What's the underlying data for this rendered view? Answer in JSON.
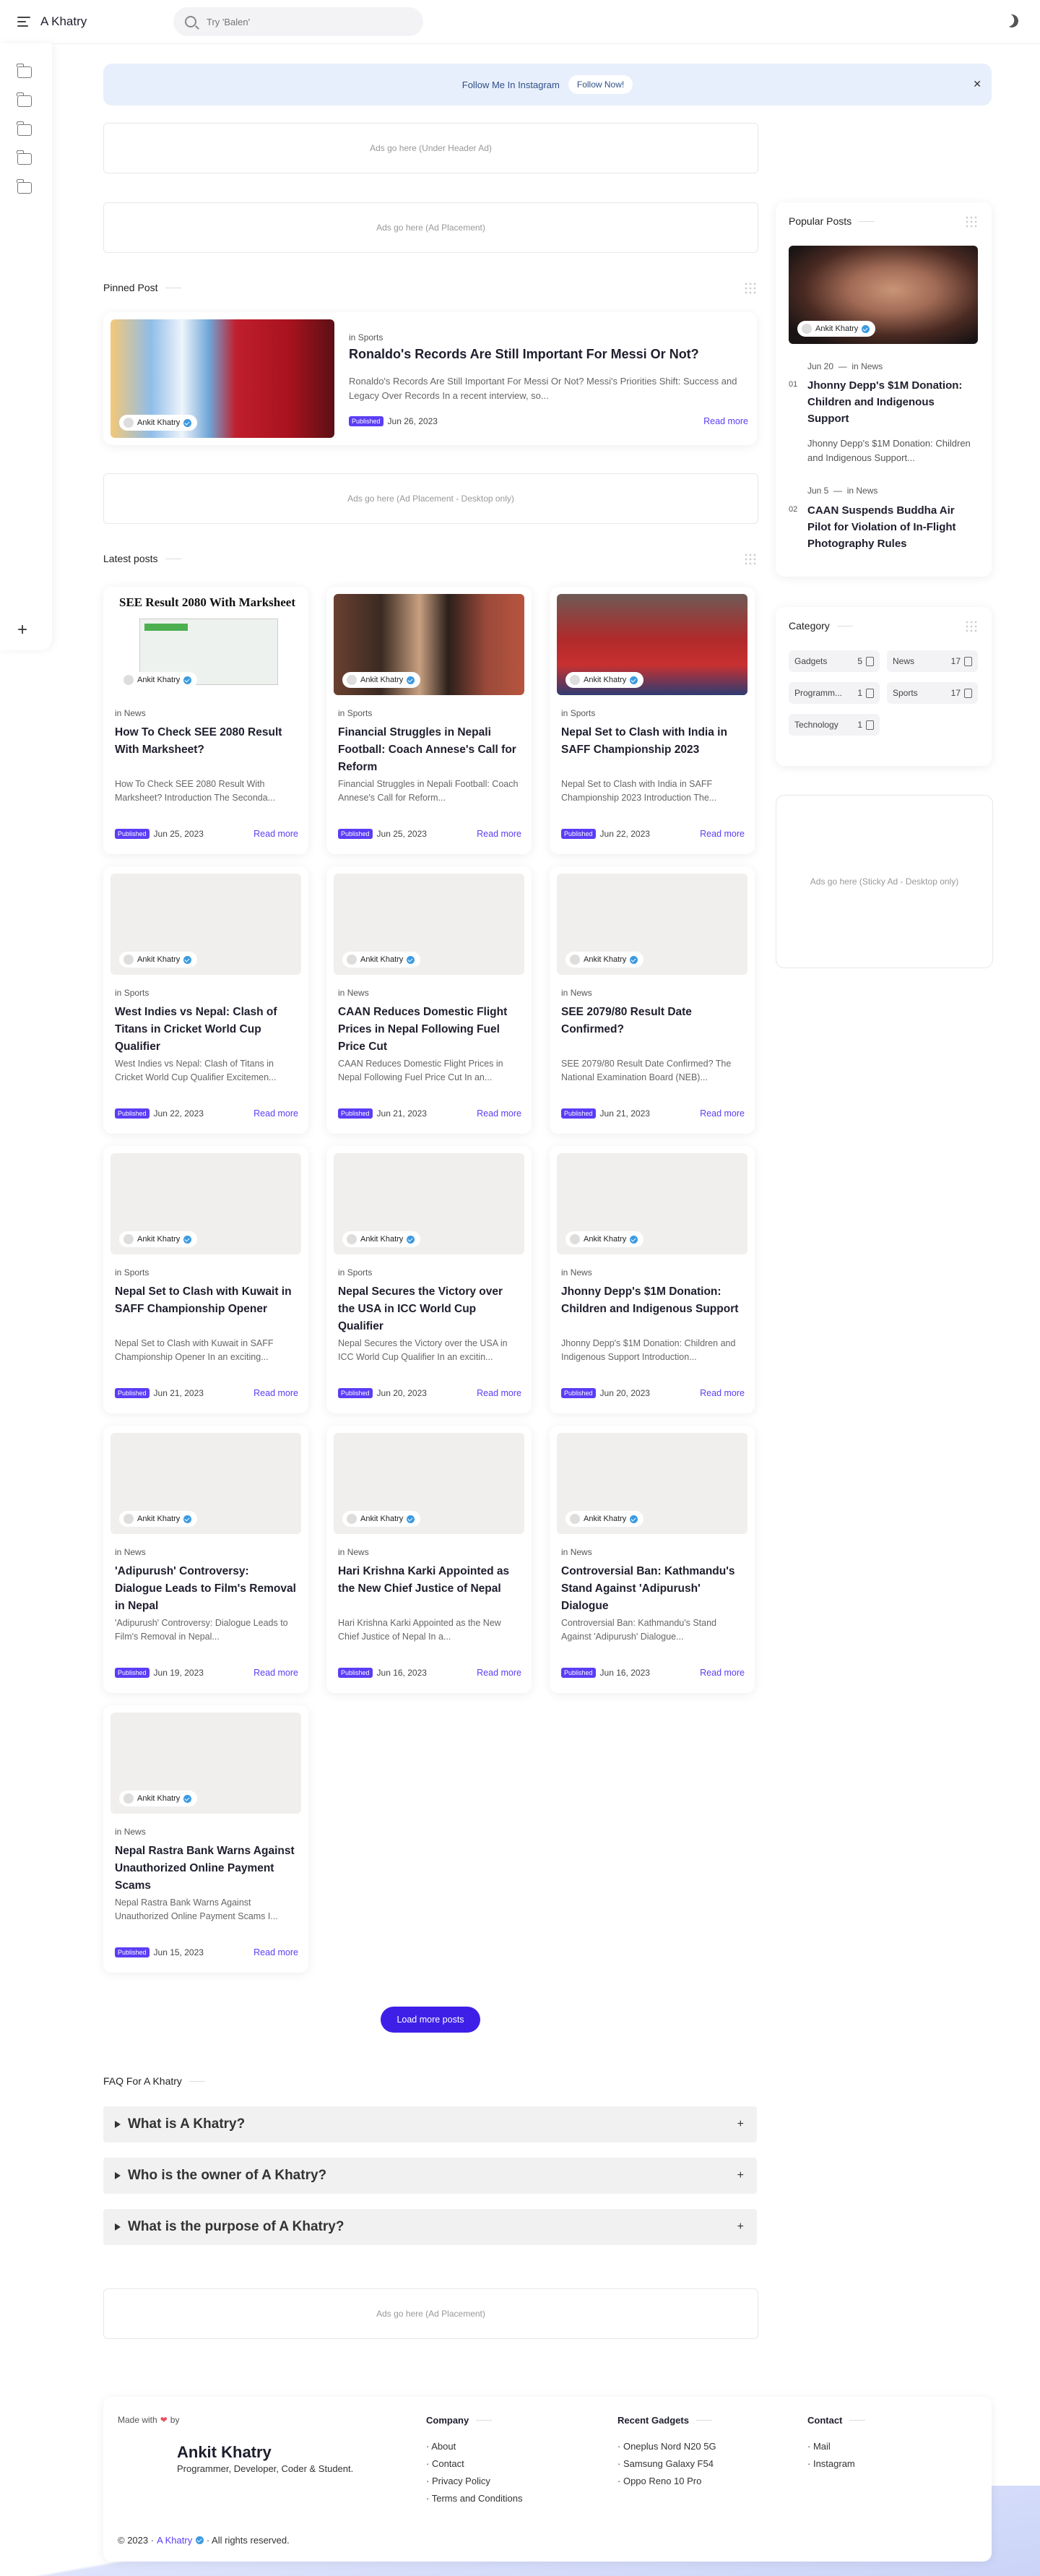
{
  "header": {
    "brand": "A Khatry",
    "search_placeholder": "Try 'Balen'"
  },
  "notice": {
    "text": "Follow Me In Instagram",
    "button": "Follow Now!"
  },
  "ads": {
    "under_header": "Ads go here (Under Header Ad)",
    "placement": "Ads go here (Ad Placement)",
    "placement_desktop": "Ads go here (Ad Placement - Desktop only)",
    "sticky": "Ads go here (Sticky Ad - Desktop only)",
    "bottom": "Ads go here (Ad Placement)"
  },
  "pinned": {
    "section_title": "Pinned Post",
    "category_prefix": "in",
    "category": "Sports",
    "title": "Ronaldo's Records Are Still Important For Messi Or Not?",
    "excerpt": "Ronaldo's Records Are Still Important For Messi Or Not? Messi's Priorities Shift: Success and Legacy Over Records In a recent interview, so...",
    "badge": "Published",
    "date": "Jun 26, 2023",
    "author": "Ankit Khatry",
    "read_more": "Read more"
  },
  "latest": {
    "section_title": "Latest posts",
    "author": "Ankit Khatry",
    "badge": "Published",
    "read_more": "Read more",
    "category_prefix": "in",
    "first_thumb_heading": "SEE Result 2080 With Marksheet",
    "posts": [
      {
        "category": "News",
        "title": "How To Check SEE 2080 Result With Marksheet?",
        "excerpt": "How To Check SEE 2080 Result With Marksheet? Introduction The Seconda...",
        "date": "Jun 25, 2023"
      },
      {
        "category": "Sports",
        "title": "Financial Struggles in Nepali Football: Coach Annese's Call for Reform",
        "excerpt": "Financial Struggles in Nepali Football: Coach Annese's Call for Reform...",
        "date": "Jun 25, 2023"
      },
      {
        "category": "Sports",
        "title": "Nepal Set to Clash with India in SAFF Championship 2023",
        "excerpt": "Nepal Set to Clash with India in SAFF Championship 2023 Introduction The...",
        "date": "Jun 22, 2023"
      },
      {
        "category": "Sports",
        "title": "West Indies vs Nepal: Clash of Titans in Cricket World Cup Qualifier",
        "excerpt": "West Indies vs Nepal: Clash of Titans in Cricket World Cup Qualifier Excitemen...",
        "date": "Jun 22, 2023"
      },
      {
        "category": "News",
        "title": "CAAN Reduces Domestic Flight Prices in Nepal Following Fuel Price Cut",
        "excerpt": "CAAN Reduces Domestic Flight Prices in Nepal Following Fuel Price Cut In an...",
        "date": "Jun 21, 2023"
      },
      {
        "category": "News",
        "title": "SEE 2079/80 Result Date Confirmed?",
        "excerpt": "SEE 2079/80 Result Date Confirmed? The National Examination Board (NEB)...",
        "date": "Jun 21, 2023"
      },
      {
        "category": "Sports",
        "title": "Nepal Set to Clash with Kuwait in SAFF Championship Opener",
        "excerpt": "Nepal Set to Clash with Kuwait in SAFF Championship Opener In an exciting...",
        "date": "Jun 21, 2023"
      },
      {
        "category": "Sports",
        "title": "Nepal Secures the Victory over the USA in ICC World Cup Qualifier",
        "excerpt": "Nepal Secures the Victory over the USA in ICC World Cup Qualifier In an excitin...",
        "date": "Jun 20, 2023"
      },
      {
        "category": "News",
        "title": "Jhonny Depp's $1M Donation: Children and Indigenous Support",
        "excerpt": "Jhonny Depp's $1M Donation: Children and Indigenous Support Introduction...",
        "date": "Jun 20, 2023"
      },
      {
        "category": "News",
        "title": "'Adipurush' Controversy: Dialogue Leads to Film's Removal in Nepal",
        "excerpt": "'Adipurush' Controversy: Dialogue Leads to Film's Removal in Nepal...",
        "date": "Jun 19, 2023"
      },
      {
        "category": "News",
        "title": "Hari Krishna Karki Appointed as the New Chief Justice of Nepal",
        "excerpt": "Hari Krishna Karki Appointed as the New Chief Justice of Nepal In a...",
        "date": "Jun 16, 2023"
      },
      {
        "category": "News",
        "title": "Controversial Ban: Kathmandu's Stand Against 'Adipurush' Dialogue",
        "excerpt": "Controversial Ban: Kathmandu's Stand Against 'Adipurush' Dialogue...",
        "date": "Jun 16, 2023"
      },
      {
        "category": "News",
        "title": "Nepal Rastra Bank Warns Against Unauthorized Online Payment Scams",
        "excerpt": "Nepal Rastra Bank Warns Against Unauthorized Online Payment Scams I...",
        "date": "Jun 15, 2023"
      }
    ],
    "load_more": "Load more posts"
  },
  "faq": {
    "section_title": "FAQ For A Khatry",
    "items": [
      "What is A Khatry?",
      "Who is the owner of A Khatry?",
      "What is the purpose of A Khatry?"
    ]
  },
  "popular": {
    "section_title": "Popular Posts",
    "author": "Ankit Khatry",
    "category_prefix": "in",
    "items": [
      {
        "num": "01",
        "date": "Jun 20",
        "category": "News",
        "title": "Jhonny Depp's $1M Donation: Children and Indigenous Support",
        "excerpt": "Jhonny Depp's $1M Donation: Children and Indigenous Support..."
      },
      {
        "num": "02",
        "date": "Jun 5",
        "category": "News",
        "title": "CAAN Suspends Buddha Air Pilot for Violation of In-Flight Photography Rules"
      }
    ]
  },
  "categories": {
    "section_title": "Category",
    "items": [
      {
        "name": "Gadgets",
        "count": "5"
      },
      {
        "name": "News",
        "count": "17"
      },
      {
        "name": "Programm...",
        "count": "1"
      },
      {
        "name": "Sports",
        "count": "17"
      },
      {
        "name": "Technology",
        "count": "1"
      }
    ]
  },
  "footer": {
    "made_with": "Made with",
    "by": "by",
    "name": "Ankit Khatry",
    "tagline": "Programmer, Developer, Coder & Student.",
    "company_title": "Company",
    "company_links": [
      "About",
      "Contact",
      "Privacy Policy",
      "Terms and Conditions"
    ],
    "gadgets_title": "Recent Gadgets",
    "gadgets_links": [
      "Oneplus Nord N20 5G",
      "Samsung Galaxy F54",
      "Oppo Reno 10 Pro"
    ],
    "contact_title": "Contact",
    "contact_links": [
      "Mail",
      "Instagram"
    ],
    "copyright": "© 2023 ·",
    "brand": "A Khatry",
    "rights": "· All rights reserved."
  },
  "colors": {
    "accent": "#5b3df5",
    "button": "#3e1fe8",
    "notice_bg": "#e8effc"
  }
}
